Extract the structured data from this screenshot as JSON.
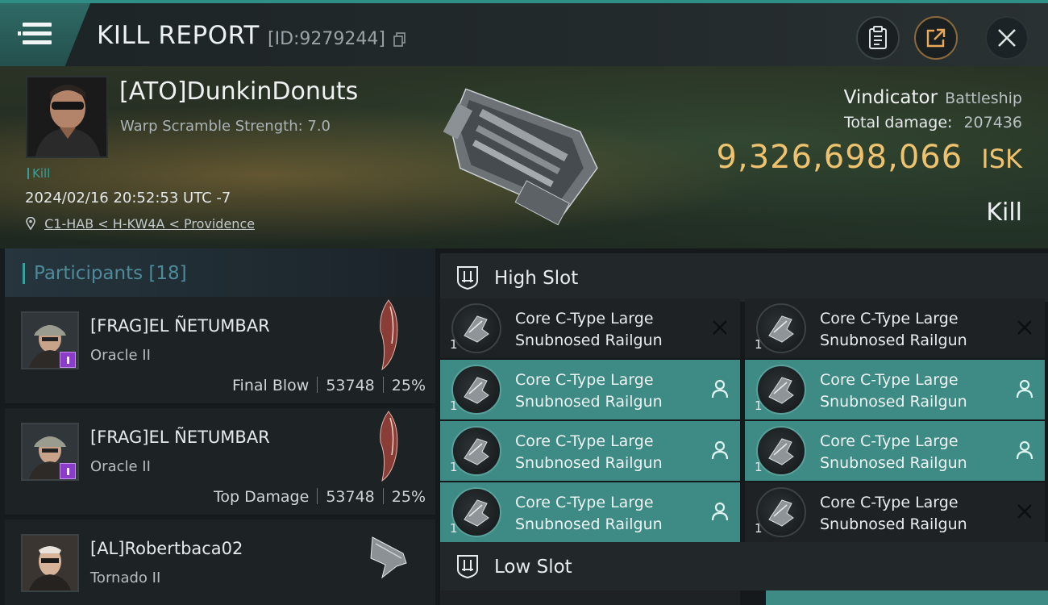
{
  "header": {
    "title": "KILL REPORT",
    "report_id": "[ID:9279244]"
  },
  "victim": {
    "name": "[ATO]DunkinDonuts",
    "scramble": "Warp Scramble Strength: 7.0",
    "kill_tag": "Kill",
    "time": "2024/02/16 20:52:53 UTC -7",
    "location": "C1-HAB < H-KW4A < Providence",
    "ship_name": "Vindicator",
    "ship_class": "Battleship",
    "total_damage_label": "Total damage:",
    "total_damage": "207436",
    "isk_value": "9,326,698,066",
    "isk_unit": "ISK",
    "result": "Kill"
  },
  "participants": {
    "header": "Participants [18]",
    "rows": [
      {
        "name": "[FRAG]EL ÑETUMBAR",
        "ship": "Oracle II",
        "role": "Final Blow",
        "damage": "53748",
        "percent": "25%"
      },
      {
        "name": "[FRAG]EL ÑETUMBAR",
        "ship": "Oracle II",
        "role": "Top Damage",
        "damage": "53748",
        "percent": "25%"
      },
      {
        "name": "[AL]Robertbaca02",
        "ship": "Tornado II",
        "role": "",
        "damage": "",
        "percent": ""
      }
    ]
  },
  "fittings": {
    "high_slot_label": "High Slot",
    "low_slot_label": "Low Slot",
    "modules": [
      {
        "name_line1": "Core C-Type Large",
        "name_line2": "Snubnosed Railgun",
        "qty": "1",
        "status": "destroyed"
      },
      {
        "name_line1": "Core C-Type Large",
        "name_line2": "Snubnosed Railgun",
        "qty": "1",
        "status": "destroyed"
      },
      {
        "name_line1": "Core C-Type Large",
        "name_line2": "Snubnosed Railgun",
        "qty": "1",
        "status": "dropped"
      },
      {
        "name_line1": "Core C-Type Large",
        "name_line2": "Snubnosed Railgun",
        "qty": "1",
        "status": "dropped"
      },
      {
        "name_line1": "Core C-Type Large",
        "name_line2": "Snubnosed Railgun",
        "qty": "1",
        "status": "dropped"
      },
      {
        "name_line1": "Core C-Type Large",
        "name_line2": "Snubnosed Railgun",
        "qty": "1",
        "status": "dropped"
      },
      {
        "name_line1": "Core C-Type Large",
        "name_line2": "Snubnosed Railgun",
        "qty": "1",
        "status": "dropped"
      },
      {
        "name_line1": "Core C-Type Large",
        "name_line2": "Snubnosed Railgun",
        "qty": "1",
        "status": "destroyed"
      }
    ]
  },
  "colors": {
    "accent": "#3a9f97",
    "isk": "#eec26e",
    "dropped_bg": "#3e8a85",
    "destroyed_bg": "#1e2224"
  }
}
